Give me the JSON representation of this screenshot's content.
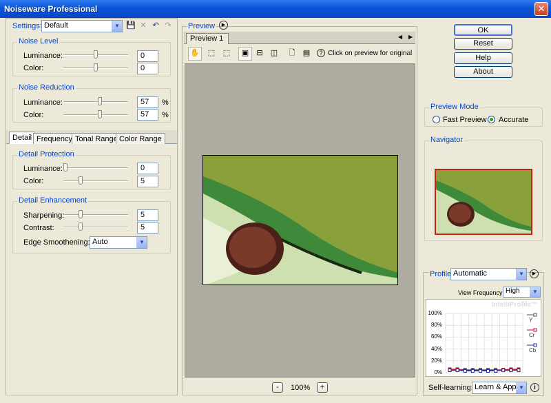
{
  "window": {
    "title": "Noiseware Professional",
    "close_glyph": "✕"
  },
  "settings": {
    "label": "Settings:",
    "value": "Default"
  },
  "noise_level": {
    "title": "Noise Level",
    "luminance": {
      "label": "Luminance:",
      "value": "0",
      "pos": 0.5
    },
    "color": {
      "label": "Color:",
      "value": "0",
      "pos": 0.5
    }
  },
  "noise_reduction": {
    "title": "Noise Reduction",
    "luminance": {
      "label": "Luminance:",
      "value": "57",
      "unit": "%",
      "pos": 0.57
    },
    "color": {
      "label": "Color:",
      "value": "57",
      "unit": "%",
      "pos": 0.57
    }
  },
  "tabs": [
    "Detail",
    "Frequency",
    "Tonal Range",
    "Color Range"
  ],
  "detail_protection": {
    "title": "Detail Protection",
    "luminance": {
      "label": "Luminance:",
      "value": "0",
      "pos": 0.0
    },
    "color": {
      "label": "Color:",
      "value": "5",
      "pos": 0.25
    }
  },
  "detail_enhancement": {
    "title": "Detail Enhancement",
    "sharpening": {
      "label": "Sharpening:",
      "value": "5",
      "pos": 0.25
    },
    "contrast": {
      "label": "Contrast:",
      "value": "5",
      "pos": 0.25
    },
    "edge": {
      "label": "Edge Smoothening:",
      "value": "Auto"
    }
  },
  "preview": {
    "title": "Preview",
    "tab": "Preview 1",
    "hint": "Click on preview for original",
    "zoom": "100%",
    "minus": "-",
    "plus": "+",
    "help_glyph": "?"
  },
  "buttons": {
    "ok": "OK",
    "reset": "Reset",
    "help": "Help",
    "about": "About"
  },
  "preview_mode": {
    "title": "Preview Mode",
    "fast": "Fast Preview",
    "accurate": "Accurate",
    "selected": "accurate"
  },
  "navigator": {
    "title": "Navigator"
  },
  "profile": {
    "label": "Profile:",
    "value": "Automatic",
    "view_freq_label": "View Frequency:",
    "view_freq_value": "High",
    "watermark": "IntelliProfile™",
    "self_learning_label": "Self-learning:",
    "self_learning_value": "Learn & Apply",
    "info_glyph": "i"
  },
  "chart_data": {
    "type": "line",
    "y_ticks": [
      "100%",
      "80%",
      "60%",
      "40%",
      "20%",
      "0%"
    ],
    "ylim": [
      0,
      100
    ],
    "x": [
      1,
      2,
      3,
      4,
      5,
      6,
      7,
      8,
      9,
      10
    ],
    "series": [
      {
        "name": "Y",
        "color": "#555555",
        "values": [
          6,
          6,
          5,
          5,
          5,
          5,
          5,
          5,
          6,
          6
        ]
      },
      {
        "name": "Cr",
        "color": "#c8003c",
        "values": [
          5,
          5,
          4,
          4,
          4,
          4,
          4,
          5,
          5,
          5
        ]
      },
      {
        "name": "Cb",
        "color": "#1e2896",
        "values": [
          4,
          4,
          3,
          3,
          3,
          3,
          3,
          4,
          4,
          4
        ]
      }
    ],
    "grid": true,
    "legend": "right"
  },
  "colors": {
    "accent": "#0046d5",
    "bg": "#ece9d8",
    "preview_bg": "#aeaba0",
    "image_green": "#8aa03a"
  }
}
